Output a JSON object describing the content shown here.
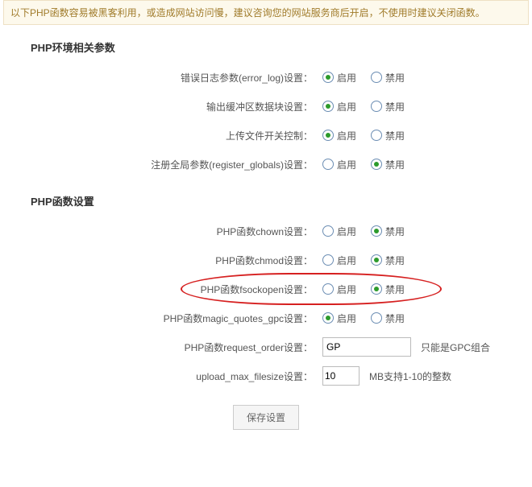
{
  "notice": "以下PHP函数容易被黑客利用，或造成网站访问慢，建议咨询您的网站服务商后开启，不使用时建议关闭函数。",
  "section_env": {
    "title": "PHP环境相关参数",
    "rows": [
      {
        "label": "错误日志参数(error_log)设置：",
        "enable": "启用",
        "disable": "禁用",
        "selected": 0
      },
      {
        "label": "输出缓冲区数据块设置：",
        "enable": "启用",
        "disable": "禁用",
        "selected": 0
      },
      {
        "label": "上传文件开关控制：",
        "enable": "启用",
        "disable": "禁用",
        "selected": 0
      },
      {
        "label": "注册全局参数(register_globals)设置：",
        "enable": "启用",
        "disable": "禁用",
        "selected": 1
      }
    ]
  },
  "section_func": {
    "title": "PHP函数设置",
    "rows": [
      {
        "label": "PHP函数chown设置：",
        "enable": "启用",
        "disable": "禁用",
        "selected": 1
      },
      {
        "label": "PHP函数chmod设置：",
        "enable": "启用",
        "disable": "禁用",
        "selected": 1
      },
      {
        "label": "PHP函数fsockopen设置：",
        "enable": "启用",
        "disable": "禁用",
        "selected": 1,
        "highlight": true
      },
      {
        "label": "PHP函数magic_quotes_gpc设置：",
        "enable": "启用",
        "disable": "禁用",
        "selected": 0
      }
    ],
    "request_order": {
      "label": "PHP函数request_order设置：",
      "value": "GP",
      "hint": "只能是GPC组合"
    },
    "upload_size": {
      "label": "upload_max_filesize设置：",
      "value": "10",
      "hint": "MB支持1-10的整数"
    }
  },
  "save_label": "保存设置"
}
